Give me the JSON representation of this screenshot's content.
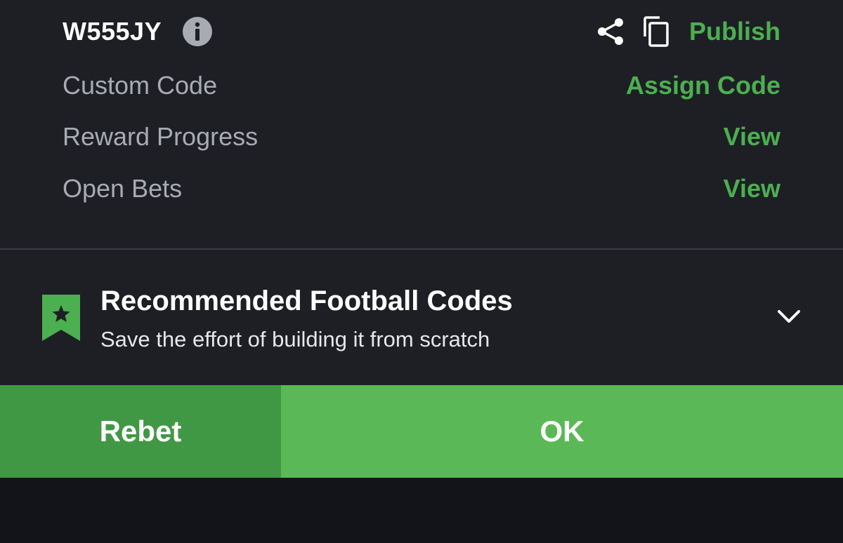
{
  "header": {
    "code": "W555JY",
    "info_icon": "info-circle-icon",
    "share_icon": "share-icon",
    "copy_icon": "copy-icon",
    "publish_label": "Publish"
  },
  "rows": [
    {
      "label": "Custom Code",
      "action": "Assign Code"
    },
    {
      "label": "Reward Progress",
      "action": "View"
    },
    {
      "label": "Open Bets",
      "action": "View"
    }
  ],
  "recommended": {
    "icon": "bookmark-star-icon",
    "title": "Recommended Football Codes",
    "subtitle": "Save the effort of building it from scratch",
    "toggle_icon": "chevron-down-icon"
  },
  "buttons": {
    "rebet_label": "Rebet",
    "ok_label": "OK"
  },
  "colors": {
    "background": "#1e1f25",
    "accent_green": "#4caf50",
    "rebet_button": "#419844",
    "ok_button": "#5ab956",
    "footer": "#131419"
  }
}
